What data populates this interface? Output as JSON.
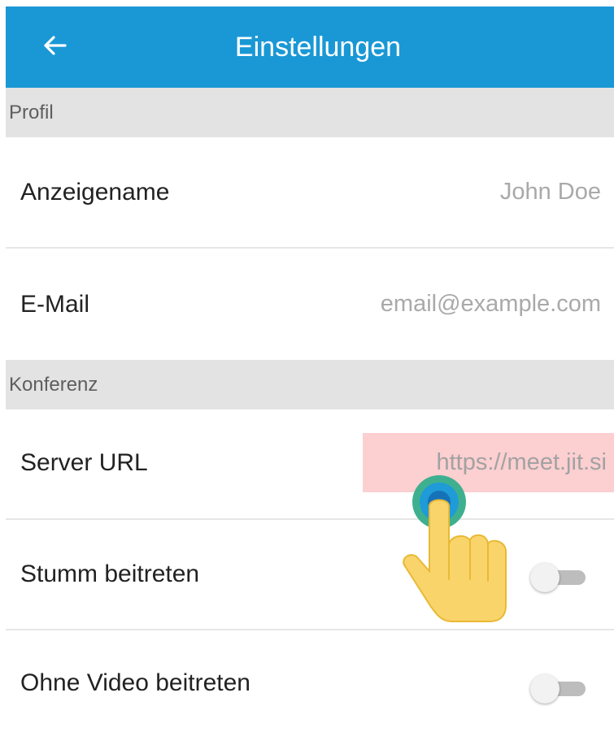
{
  "header": {
    "title": "Einstellungen",
    "back_icon": "arrow-left-icon",
    "background_color": "#1a98d5"
  },
  "sections": {
    "profile": {
      "title": "Profil",
      "display_name": {
        "label": "Anzeigename",
        "placeholder": "John Doe"
      },
      "email": {
        "label": "E-Mail",
        "placeholder": "email@example.com"
      }
    },
    "conference": {
      "title": "Konferenz",
      "server_url": {
        "label": "Server URL",
        "placeholder": "https://meet.jit.si",
        "highlight_color": "#fccfd1"
      },
      "join_muted": {
        "label": "Stumm beitreten",
        "enabled": false
      },
      "join_without_video": {
        "label": "Ohne Video beitreten",
        "enabled": false
      }
    }
  },
  "overlay": {
    "icon": "tap-hand-icon",
    "description": "tap indicator on server URL field"
  }
}
